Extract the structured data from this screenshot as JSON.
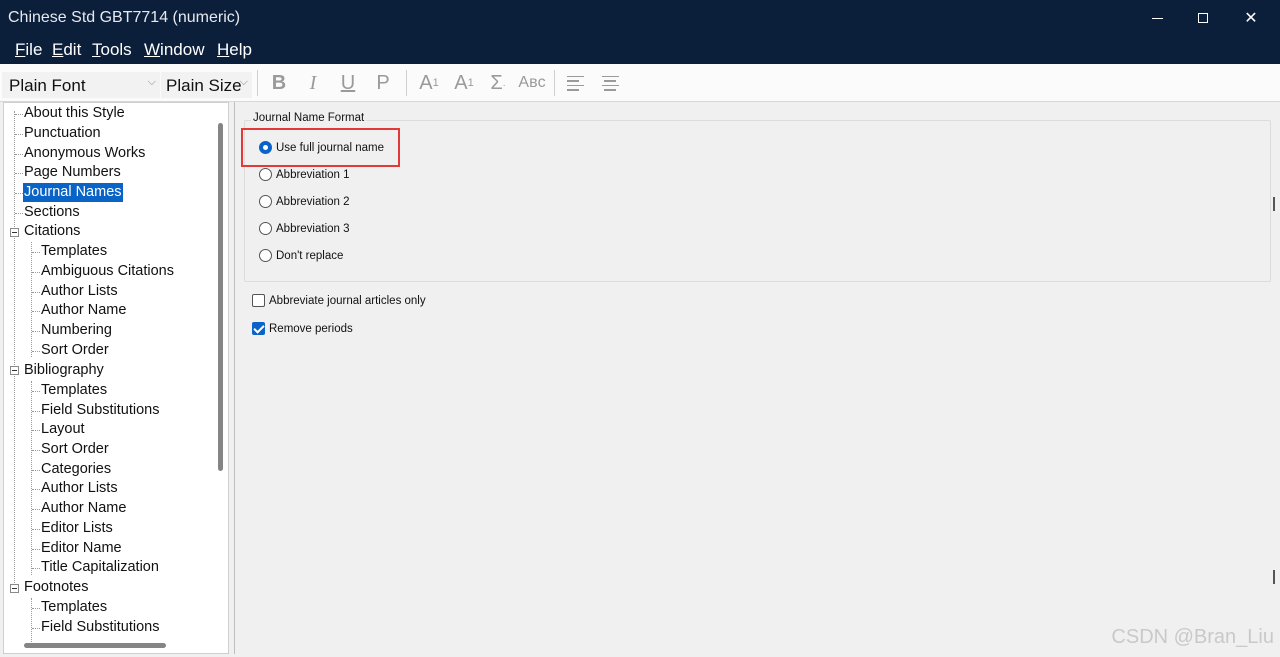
{
  "window": {
    "title": "Chinese Std GBT7714 (numeric)",
    "controls": [
      "minimize",
      "maximize",
      "close"
    ]
  },
  "menu": [
    {
      "label": "File",
      "mnemonic": "F",
      "rest": "ile"
    },
    {
      "label": "Edit",
      "mnemonic": "E",
      "rest": "dit"
    },
    {
      "label": "Tools",
      "mnemonic": "T",
      "rest": "ools"
    },
    {
      "label": "Window",
      "mnemonic": "W",
      "rest": "indow"
    },
    {
      "label": "Help",
      "mnemonic": "H",
      "rest": "elp"
    }
  ],
  "toolbar": {
    "font": "Plain Font",
    "size": "Plain Size",
    "bold": "B",
    "italic": "I",
    "underline": "U",
    "plain": "P",
    "superscript_base": "A",
    "superscript_mark": "1",
    "subscript_base": "A",
    "subscript_mark": "1",
    "symbol": "Σ",
    "smallcaps": "Aʙᴄ"
  },
  "tree": {
    "items": [
      {
        "label": "About this Style"
      },
      {
        "label": "Punctuation"
      },
      {
        "label": "Anonymous Works"
      },
      {
        "label": "Page Numbers"
      },
      {
        "label": "Journal Names",
        "selected": true
      },
      {
        "label": "Sections"
      },
      {
        "label": "Citations",
        "expanded": true
      },
      {
        "label": "Templates"
      },
      {
        "label": "Ambiguous Citations"
      },
      {
        "label": "Author Lists"
      },
      {
        "label": "Author Name"
      },
      {
        "label": "Numbering"
      },
      {
        "label": "Sort Order"
      },
      {
        "label": "Bibliography",
        "expanded": true
      },
      {
        "label": "Templates"
      },
      {
        "label": "Field Substitutions"
      },
      {
        "label": "Layout"
      },
      {
        "label": "Sort Order"
      },
      {
        "label": "Categories"
      },
      {
        "label": "Author Lists"
      },
      {
        "label": "Author Name"
      },
      {
        "label": "Editor Lists"
      },
      {
        "label": "Editor Name"
      },
      {
        "label": "Title Capitalization"
      },
      {
        "label": "Footnotes",
        "expanded": true
      },
      {
        "label": "Templates"
      },
      {
        "label": "Field Substitutions"
      }
    ]
  },
  "journal_format": {
    "group_title": "Journal Name Format",
    "options": [
      {
        "label": "Use full journal name",
        "checked": true
      },
      {
        "label": "Abbreviation 1",
        "checked": false
      },
      {
        "label": "Abbreviation 2",
        "checked": false
      },
      {
        "label": "Abbreviation 3",
        "checked": false
      },
      {
        "label": "Don't replace",
        "checked": false
      }
    ]
  },
  "checkboxes": [
    {
      "label": "Abbreviate journal articles only",
      "checked": false
    },
    {
      "label": "Remove periods",
      "checked": true
    }
  ],
  "watermark": "CSDN @Bran_Liu",
  "colors": {
    "titlebar": "#0b1f3a",
    "selection": "#0a64c8",
    "highlight": "#e23a3a"
  }
}
